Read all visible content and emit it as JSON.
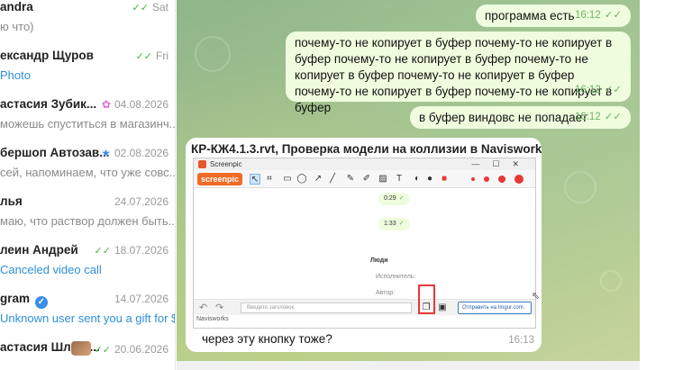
{
  "chats": [
    {
      "name": "andra",
      "date": "Sat",
      "tick": "✓✓",
      "preview": "ю что)",
      "accent": false
    },
    {
      "name": "ександр Щуров",
      "date": "Fri",
      "tick": "✓✓",
      "preview": "Photo",
      "accent": true
    },
    {
      "name": "астасия Зубик...",
      "date": "04.08.2026",
      "pin": "✿",
      "preview": "можешь спуститься в магазинч...",
      "accent": false
    },
    {
      "name": "бершоп Автозав...",
      "date": "02.08.2026",
      "star": "★",
      "preview": "сей, напоминаем, что уже совс...",
      "accent": false
    },
    {
      "name": "лья",
      "date": "24.07.2026",
      "preview": "маю, что раствор должен быть...",
      "accent": false
    },
    {
      "name": "леин Андрей",
      "date": "18.07.2026",
      "tick": "✓✓",
      "preview": "Canceled video call",
      "accent": true
    },
    {
      "name": "gram",
      "date": "14.07.2026",
      "verified": "✓",
      "preview": "Unknown user sent you a gift for $...",
      "accent": true
    },
    {
      "name": "астасия Шляхт...",
      "date": "20.06.2026",
      "tick": "✓✓",
      "preview": "",
      "accent": false
    }
  ],
  "messages": {
    "m1": {
      "text": "программа есть",
      "time": "16:12",
      "tick": "✓✓"
    },
    "m2": {
      "text": "почему-то не копирует в буфер почему-то не копирует в буфер почему-то не копирует в буфер почему-то не копирует в буфер почему-то не копирует в буфер почему-то не копирует в буфер почему-то не копирует в буфер",
      "time": "16:12",
      "tick": "✓✓"
    },
    "m3": {
      "text": "в буфер виндовс не попадает",
      "time": "16:12",
      "tick": "✓✓"
    }
  },
  "incoming": {
    "file_title": "КР-КЖ4.1.3.rvt, Проверка модели на коллизии в Navisworks",
    "caption": "через эту кнопку тоже?",
    "time": "16:13"
  },
  "screenshot": {
    "window_title": "Screenpic",
    "logo": "screenpic",
    "pill1": "0:29",
    "pill2": "1:33",
    "tick": "✓",
    "people": "Люди",
    "executor": "Исполнитель:",
    "author": "Автор:",
    "title_placeholder": "Введите заголовок",
    "imgur_label": "Отправить на Imgur.com",
    "footer": "Navisworks"
  },
  "colors": {
    "accent": "#4fae4e",
    "outgoing_bubble": "#effdde",
    "link": "#2f8fd8",
    "highlight": "#e53935"
  }
}
